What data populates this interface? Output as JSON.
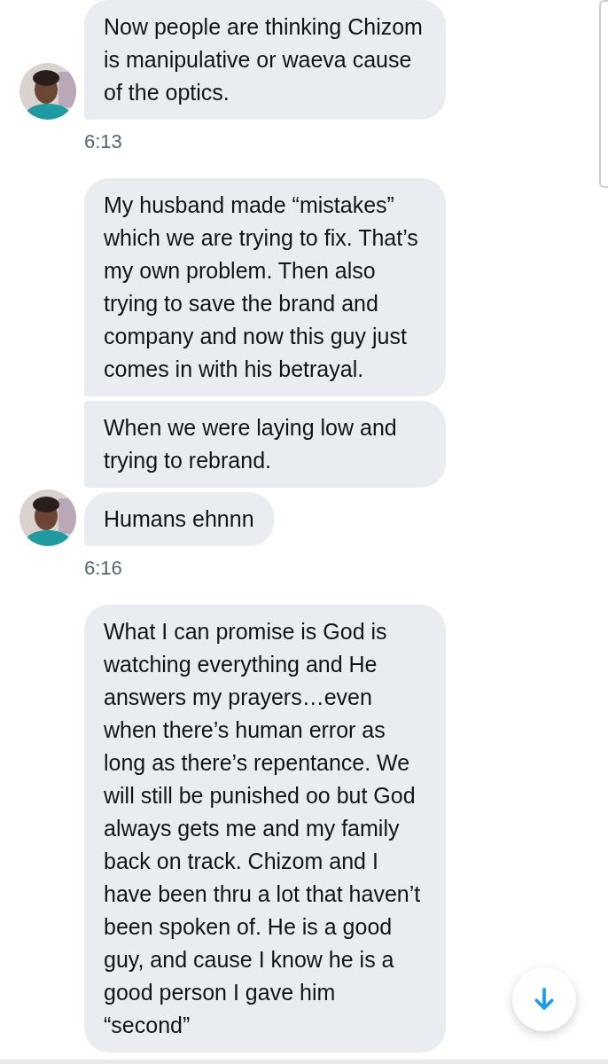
{
  "messages_groups": [
    {
      "messages": [
        {
          "text": "Now people are thinking Chizom is manipulative or waeva cause of the optics."
        }
      ],
      "avatar": true,
      "time": "6:13"
    },
    {
      "messages": [
        {
          "text": "My husband made “mistakes” which we are trying to fix. That’s my own problem. Then also trying to save the brand and company and now this guy just comes in with his betrayal."
        },
        {
          "text": "When we were laying low and trying to rebrand."
        },
        {
          "text": "Humans ehnnn"
        }
      ],
      "avatar": true,
      "time": "6:16"
    },
    {
      "messages": [
        {
          "text": "What I can promise is God is watching everything and He answers my prayers…even when there’s human error as long as there’s repentance. We will still be punished oo but God always gets me and my family back on track. Chizom and I have been thru a lot that haven’t been spoken of. He is a good guy, and cause I know he is a good person I gave him “second”"
        }
      ],
      "avatar": false
    }
  ]
}
